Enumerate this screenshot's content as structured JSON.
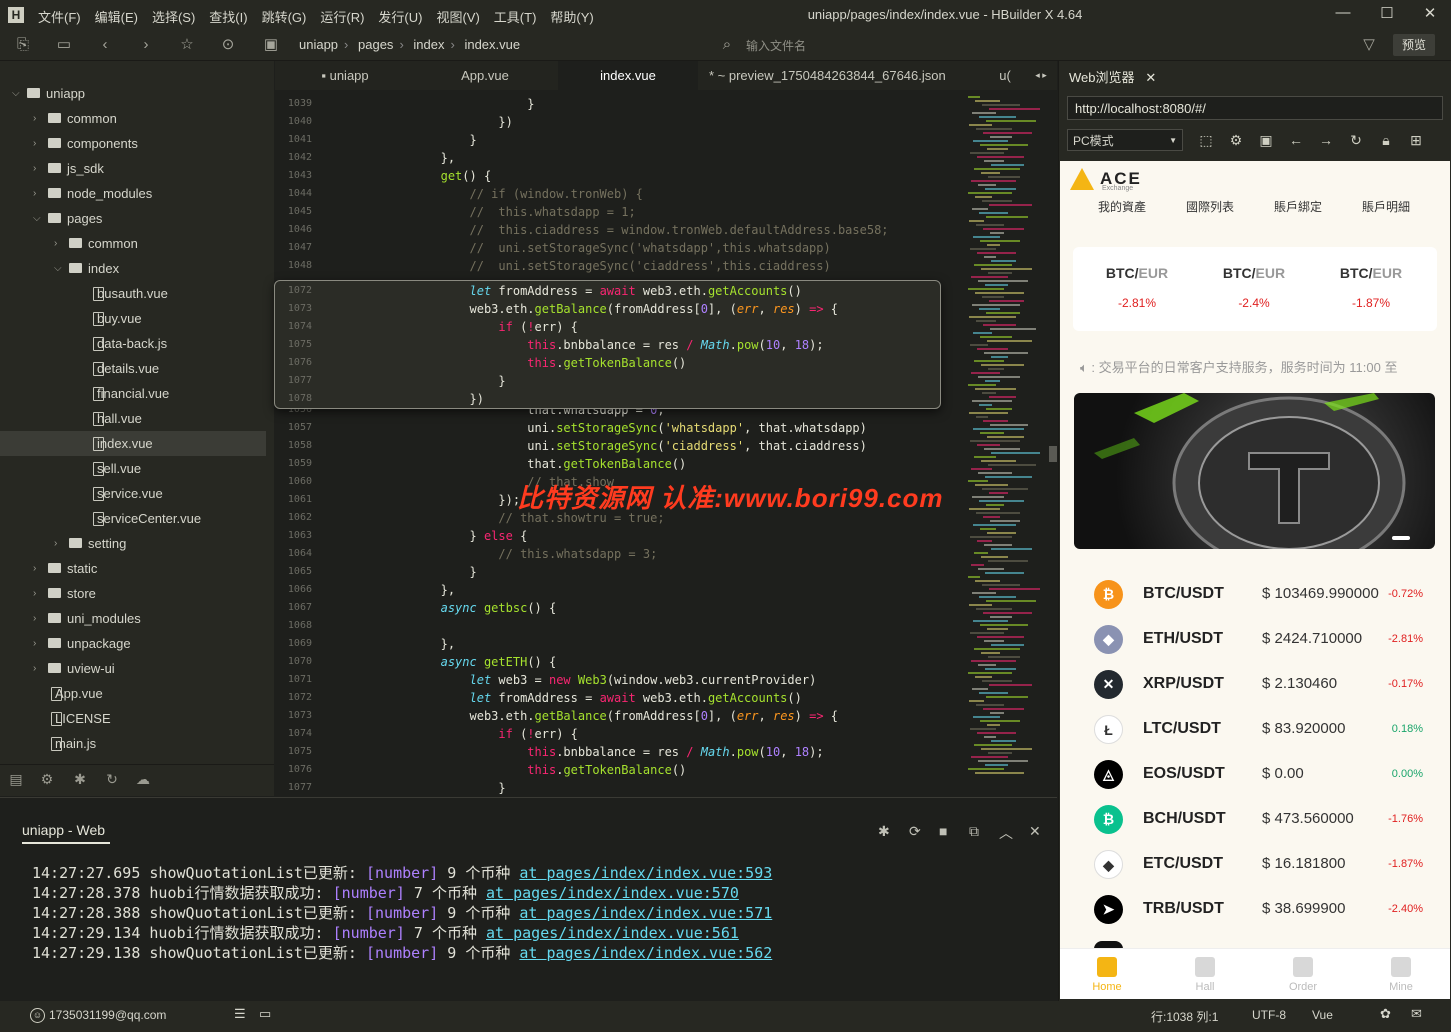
{
  "window": {
    "title": "uniapp/pages/index/index.vue - HBuilder X 4.64",
    "menu": [
      "文件(F)",
      "编辑(E)",
      "选择(S)",
      "查找(I)",
      "跳转(G)",
      "运行(R)",
      "发行(U)",
      "视图(V)",
      "工具(T)",
      "帮助(Y)"
    ]
  },
  "toolbar": {
    "breadcrumb": [
      "uniapp",
      "pages",
      "index",
      "index.vue"
    ],
    "file_search_placeholder": "输入文件名",
    "preview_label": "预览"
  },
  "sidebar": {
    "items": [
      {
        "label": "uniapp",
        "depth": 0,
        "type": "project",
        "expanded": true
      },
      {
        "label": "common",
        "depth": 1,
        "type": "folder"
      },
      {
        "label": "components",
        "depth": 1,
        "type": "folder"
      },
      {
        "label": "js_sdk",
        "depth": 1,
        "type": "folder"
      },
      {
        "label": "node_modules",
        "depth": 1,
        "type": "folder"
      },
      {
        "label": "pages",
        "depth": 1,
        "type": "folder",
        "expanded": true
      },
      {
        "label": "common",
        "depth": 2,
        "type": "folder"
      },
      {
        "label": "index",
        "depth": 2,
        "type": "folder",
        "expanded": true
      },
      {
        "label": "busauth.vue",
        "depth": 3,
        "type": "file"
      },
      {
        "label": "buy.vue",
        "depth": 3,
        "type": "file"
      },
      {
        "label": "data-back.js",
        "depth": 3,
        "type": "file"
      },
      {
        "label": "details.vue",
        "depth": 3,
        "type": "file"
      },
      {
        "label": "financial.vue",
        "depth": 3,
        "type": "file"
      },
      {
        "label": "hall.vue",
        "depth": 3,
        "type": "file"
      },
      {
        "label": "index.vue",
        "depth": 3,
        "type": "file",
        "selected": true
      },
      {
        "label": "sell.vue",
        "depth": 3,
        "type": "file"
      },
      {
        "label": "service.vue",
        "depth": 3,
        "type": "file"
      },
      {
        "label": "serviceCenter.vue",
        "depth": 3,
        "type": "file"
      },
      {
        "label": "setting",
        "depth": 2,
        "type": "folder"
      },
      {
        "label": "static",
        "depth": 1,
        "type": "folder"
      },
      {
        "label": "store",
        "depth": 1,
        "type": "folder"
      },
      {
        "label": "uni_modules",
        "depth": 1,
        "type": "folder"
      },
      {
        "label": "unpackage",
        "depth": 1,
        "type": "folder"
      },
      {
        "label": "uview-ui",
        "depth": 1,
        "type": "folder"
      },
      {
        "label": "App.vue",
        "depth": 1,
        "type": "file"
      },
      {
        "label": "LICENSE",
        "depth": 1,
        "type": "file"
      },
      {
        "label": "main.js",
        "depth": 1,
        "type": "file"
      }
    ]
  },
  "editor": {
    "tabs": [
      {
        "label": "uniapp",
        "active": false
      },
      {
        "label": "App.vue",
        "active": false
      },
      {
        "label": "index.vue",
        "active": true
      },
      {
        "label": "* ~ preview_1750484263844_67646.json",
        "active": false
      },
      {
        "label": "u(",
        "active": false
      }
    ],
    "lines": [
      {
        "n": "1039",
        "html": "            }"
      },
      {
        "n": "1040",
        "html": "        })"
      },
      {
        "n": "1041",
        "html": "    }"
      },
      {
        "n": "1042",
        "html": "},"
      },
      {
        "n": "1043",
        "html": "<span class='c-fn'>get</span>() {"
      },
      {
        "n": "1044",
        "html": "    <span class='c-com'>// if (window.tronWeb) {</span>"
      },
      {
        "n": "1045",
        "html": "    <span class='c-com'>//  this.whatsdapp = 1;</span>"
      },
      {
        "n": "1046",
        "html": "    <span class='c-com'>//  this.ciaddress = window.tronWeb.defaultAddress.base58;</span>"
      },
      {
        "n": "1047",
        "html": "    <span class='c-com'>//  uni.setStorageSync('whatsdapp',this.whatsdapp)</span>"
      },
      {
        "n": "1048",
        "html": "    <span class='c-com'>//  uni.setStorageSync('ciaddress',this.ciaddress)</span>"
      },
      {
        "n": "",
        "html": ""
      },
      {
        "n": "",
        "html": ""
      },
      {
        "n": "",
        "html": ""
      },
      {
        "n": "",
        "html": ""
      },
      {
        "n": "",
        "html": ""
      },
      {
        "n": "",
        "html": ""
      },
      {
        "n": "",
        "html": ""
      },
      {
        "n": "1056",
        "html": "            that.whatsdapp = <span class='c-num'>0</span>;"
      },
      {
        "n": "1057",
        "html": "            uni.<span class='c-fn'>setStorageSync</span>(<span class='c-str'>'whatsdapp'</span>, that.whatsdapp)"
      },
      {
        "n": "1058",
        "html": "            uni.<span class='c-fn'>setStorageSync</span>(<span class='c-str'>'ciaddress'</span>, that.ciaddress)"
      },
      {
        "n": "1059",
        "html": "            that.<span class='c-fn'>getTokenBalance</span>()"
      },
      {
        "n": "1060",
        "html": "            <span class='c-com'>// that.show</span>"
      },
      {
        "n": "1061",
        "html": "        });"
      },
      {
        "n": "1062",
        "html": "        <span class='c-com'>// that.showtru = true;</span>"
      },
      {
        "n": "1063",
        "html": "    } <span class='c-kw'>else</span> {"
      },
      {
        "n": "1064",
        "html": "        <span class='c-com'>// this.whatsdapp = 3;</span>"
      },
      {
        "n": "1065",
        "html": "    }"
      },
      {
        "n": "1066",
        "html": "},"
      },
      {
        "n": "1067",
        "html": "<span class='c-kw2'>async</span> <span class='c-fn'>getbsc</span>() {"
      },
      {
        "n": "1068",
        "html": ""
      },
      {
        "n": "1069",
        "html": "},"
      },
      {
        "n": "1070",
        "html": "<span class='c-kw2'>async</span> <span class='c-fn'>getETH</span>() {"
      },
      {
        "n": "1071",
        "html": "    <span class='c-kw2'>let</span> web3 = <span class='c-kw'>new</span> <span class='c-fn'>Web3</span>(window.web3.currentProvider)"
      },
      {
        "n": "1072",
        "html": "    <span class='c-kw2'>let</span> fromAddress = <span class='c-kw'>await</span> web3.eth.<span class='c-fn'>getAccounts</span>()"
      },
      {
        "n": "1073",
        "html": "    web3.eth.<span class='c-fn'>getBalance</span>(fromAddress[<span class='c-num'>0</span>], (<span class='c-it'>err</span>, <span class='c-it'>res</span>) <span class='c-kw'>=></span> {"
      },
      {
        "n": "1074",
        "html": "        <span class='c-kw'>if</span> (<span class='c-kw'>!</span>err) {"
      },
      {
        "n": "1075",
        "html": "            <span class='c-kw'>this</span>.bnbbalance = res <span class='c-kw'>/</span> <span class='c-kw2'>Math</span>.<span class='c-fn'>pow</span>(<span class='c-num'>10</span>, <span class='c-num'>18</span>);"
      },
      {
        "n": "1076",
        "html": "            <span class='c-kw'>this</span>.<span class='c-fn'>getTokenBalance</span>()"
      },
      {
        "n": "1077",
        "html": "        }"
      }
    ],
    "peek_lines": [
      {
        "n": "1072",
        "html": "    <span class='c-kw2'>let</span> fromAddress = <span class='c-kw'>await</span> web3.eth.<span class='c-fn'>getAccounts</span>()"
      },
      {
        "n": "1073",
        "html": "    web3.eth.<span class='c-fn'>getBalance</span>(fromAddress[<span class='c-num'>0</span>], (<span class='c-it'>err</span>, <span class='c-it'>res</span>) <span class='c-kw'>=></span> {"
      },
      {
        "n": "1074",
        "html": "        <span class='c-kw'>if</span> (<span class='c-kw'>!</span>err) {"
      },
      {
        "n": "1075",
        "html": "            <span class='c-kw'>this</span>.bnbbalance = res <span class='c-kw'>/</span> <span class='c-kw2'>Math</span>.<span class='c-fn'>pow</span>(<span class='c-num'>10</span>, <span class='c-num'>18</span>);"
      },
      {
        "n": "1076",
        "html": "            <span class='c-kw'>this</span>.<span class='c-fn'>getTokenBalance</span>()"
      },
      {
        "n": "1077",
        "html": "        }"
      },
      {
        "n": "1078",
        "html": "    })"
      }
    ],
    "watermark": "比特资源网 认准:www.bori99.com"
  },
  "console": {
    "title": "uniapp - Web",
    "logs": [
      {
        "time": "14:27:27.695",
        "msg": "showQuotationList已更新:",
        "type": "[number]",
        "count": "9",
        "unit": "个币种",
        "link": "at pages/index/index.vue:593"
      },
      {
        "time": "14:27:28.378",
        "msg": "huobi行情数据获取成功:",
        "type": "[number]",
        "count": "7",
        "unit": "个币种",
        "link": "at pages/index/index.vue:570"
      },
      {
        "time": "14:27:28.388",
        "msg": "showQuotationList已更新:",
        "type": "[number]",
        "count": "9",
        "unit": "个币种",
        "link": "at pages/index/index.vue:571"
      },
      {
        "time": "14:27:29.134",
        "msg": "huobi行情数据获取成功:",
        "type": "[number]",
        "count": "7",
        "unit": "个币种",
        "link": "at pages/index/index.vue:561"
      },
      {
        "time": "14:27:29.138",
        "msg": "showQuotationList已更新:",
        "type": "[number]",
        "count": "9",
        "unit": "个币种",
        "link": "at pages/index/index.vue:562"
      }
    ]
  },
  "statusbar": {
    "user": "1735031199@qq.com",
    "position": "行:1038  列:1",
    "encoding": "UTF-8",
    "language": "Vue"
  },
  "browser": {
    "tab_label": "Web浏览器",
    "url": "http://localhost:8080/#/",
    "mode": "PC模式",
    "app": {
      "logo_text": "ACE",
      "logo_sub": "Exchange",
      "nav": [
        "我的資產",
        "國際列表",
        "賬戶綁定",
        "賬戶明細"
      ],
      "tickers": [
        {
          "base": "BTC/",
          "quote": "EUR",
          "change": "-2.81%"
        },
        {
          "base": "BTC/",
          "quote": "EUR",
          "change": "-2.4%"
        },
        {
          "base": "BTC/",
          "quote": "EUR",
          "change": "-1.87%"
        }
      ],
      "notice": "交易平台的日常客户支持服务，服务时间为 11:00 至",
      "coins": [
        {
          "pair": "BTC/USDT",
          "price": "$ 103469.990000",
          "change": "-0.72%",
          "icon": "bitcoin-icon",
          "symbol": "₿",
          "color": "#f7931a",
          "change_color": "#e02020"
        },
        {
          "pair": "ETH/USDT",
          "price": "$ 2424.710000",
          "change": "-2.81%",
          "icon": "ethereum-icon",
          "symbol": "◆",
          "color": "#8a92b2",
          "change_color": "#e02020"
        },
        {
          "pair": "XRP/USDT",
          "price": "$ 2.130460",
          "change": "-0.17%",
          "icon": "xrp-icon",
          "symbol": "✕",
          "color": "#23292f",
          "change_color": "#e02020"
        },
        {
          "pair": "LTC/USDT",
          "price": "$ 83.920000",
          "change": "0.18%",
          "icon": "litecoin-icon",
          "symbol": "Ł",
          "color": "#ffffff",
          "change_color": "#1aa56b"
        },
        {
          "pair": "EOS/USDT",
          "price": "$ 0.00",
          "change": "0.00%",
          "icon": "eos-icon",
          "symbol": "◬",
          "color": "#000000",
          "change_color": "#1aa56b"
        },
        {
          "pair": "BCH/USDT",
          "price": "$ 473.560000",
          "change": "-1.76%",
          "icon": "bitcoin-cash-icon",
          "symbol": "₿",
          "color": "#0ac18e",
          "change_color": "#e02020"
        },
        {
          "pair": "ETC/USDT",
          "price": "$ 16.181800",
          "change": "-1.87%",
          "icon": "ethereum-classic-icon",
          "symbol": "◆",
          "color": "#ffffff",
          "change_color": "#e02020"
        },
        {
          "pair": "TRB/USDT",
          "price": "$ 38.699900",
          "change": "-2.40%",
          "icon": "trb-icon",
          "symbol": "➤",
          "color": "#000000",
          "change_color": "#e02020"
        }
      ],
      "bottom_nav": [
        {
          "label": "Home",
          "active": true
        },
        {
          "label": "Hall",
          "active": false
        },
        {
          "label": "Order",
          "active": false
        },
        {
          "label": "Mine",
          "active": false
        }
      ]
    }
  },
  "colors": {
    "accent": "#f4b514",
    "negative": "#e02020",
    "positive": "#1aa56b"
  }
}
